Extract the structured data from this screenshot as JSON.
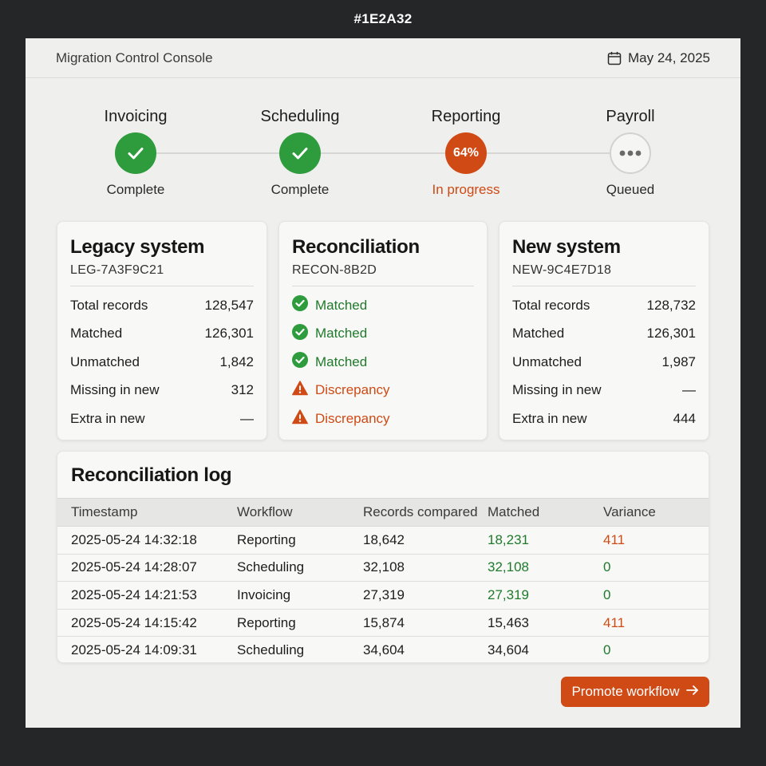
{
  "topbar": {
    "label": "#1E2A32"
  },
  "header": {
    "title": "Migration Control Console",
    "date": "May 24, 2025",
    "date_icon": "calendar-icon"
  },
  "colors": {
    "accent": "#cf4a14",
    "success": "#2e9c3d",
    "success_text": "#1f7a2b",
    "background": "#242628",
    "panel": "#efefed"
  },
  "stepper": {
    "steps": [
      {
        "name": "Invoicing",
        "state": "complete",
        "status": "Complete",
        "icon": "check-icon"
      },
      {
        "name": "Scheduling",
        "state": "complete",
        "status": "Complete",
        "icon": "check-icon"
      },
      {
        "name": "Reporting",
        "state": "progress",
        "status": "In progress",
        "progress": "64%"
      },
      {
        "name": "Payroll",
        "state": "queued",
        "status": "Queued",
        "icon": "ellipsis-icon"
      }
    ]
  },
  "legacy": {
    "title": "Legacy system",
    "id": "LEG-7A3F9C21",
    "rows": [
      {
        "label": "Total records",
        "value": "128,547"
      },
      {
        "label": "Matched",
        "value": "126,301"
      },
      {
        "label": "Unmatched",
        "value": "1,842"
      },
      {
        "label": "Missing in new",
        "value": "312"
      },
      {
        "label": "Extra in new",
        "value": "—"
      }
    ]
  },
  "reconciliation": {
    "title": "Reconciliation",
    "id": "RECON-8B2D",
    "rows": [
      {
        "label": "Matched",
        "state": "ok",
        "icon": "check-circle-icon"
      },
      {
        "label": "Matched",
        "state": "ok",
        "icon": "check-circle-icon"
      },
      {
        "label": "Matched",
        "state": "ok",
        "icon": "check-circle-icon"
      },
      {
        "label": "Discrepancy",
        "state": "warn",
        "icon": "warning-icon"
      },
      {
        "label": "Discrepancy",
        "state": "warn",
        "icon": "warning-icon"
      }
    ]
  },
  "newsys": {
    "title": "New system",
    "id": "NEW-9C4E7D18",
    "rows": [
      {
        "label": "Total records",
        "value": "128,732"
      },
      {
        "label": "Matched",
        "value": "126,301"
      },
      {
        "label": "Unmatched",
        "value": "1,987"
      },
      {
        "label": "Missing in new",
        "value": "—"
      },
      {
        "label": "Extra in new",
        "value": "444"
      }
    ]
  },
  "log": {
    "title": "Reconciliation log",
    "columns": [
      "Timestamp",
      "Workflow",
      "Records compared",
      "Matched",
      "Variance"
    ],
    "rows": [
      {
        "timestamp": "2025-05-24 14:32:18",
        "workflow": "Reporting",
        "compared": "18,642",
        "matched": "18,231",
        "variance": "411",
        "matched_color": "green",
        "variance_color": "orange"
      },
      {
        "timestamp": "2025-05-24 14:28:07",
        "workflow": "Scheduling",
        "compared": "32,108",
        "matched": "32,108",
        "variance": "0",
        "matched_color": "green",
        "variance_color": "green"
      },
      {
        "timestamp": "2025-05-24 14:21:53",
        "workflow": "Invoicing",
        "compared": "27,319",
        "matched": "27,319",
        "variance": "0",
        "matched_color": "green",
        "variance_color": "green"
      },
      {
        "timestamp": "2025-05-24 14:15:42",
        "workflow": "Reporting",
        "compared": "15,874",
        "matched": "15,463",
        "variance": "411",
        "matched_color": "plain",
        "variance_color": "orange"
      },
      {
        "timestamp": "2025-05-24 14:09:31",
        "workflow": "Scheduling",
        "compared": "34,604",
        "matched": "34,604",
        "variance": "0",
        "matched_color": "plain",
        "variance_color": "green"
      }
    ]
  },
  "actions": {
    "promote_label": "Promote workflow",
    "promote_icon": "arrow-right-icon"
  }
}
